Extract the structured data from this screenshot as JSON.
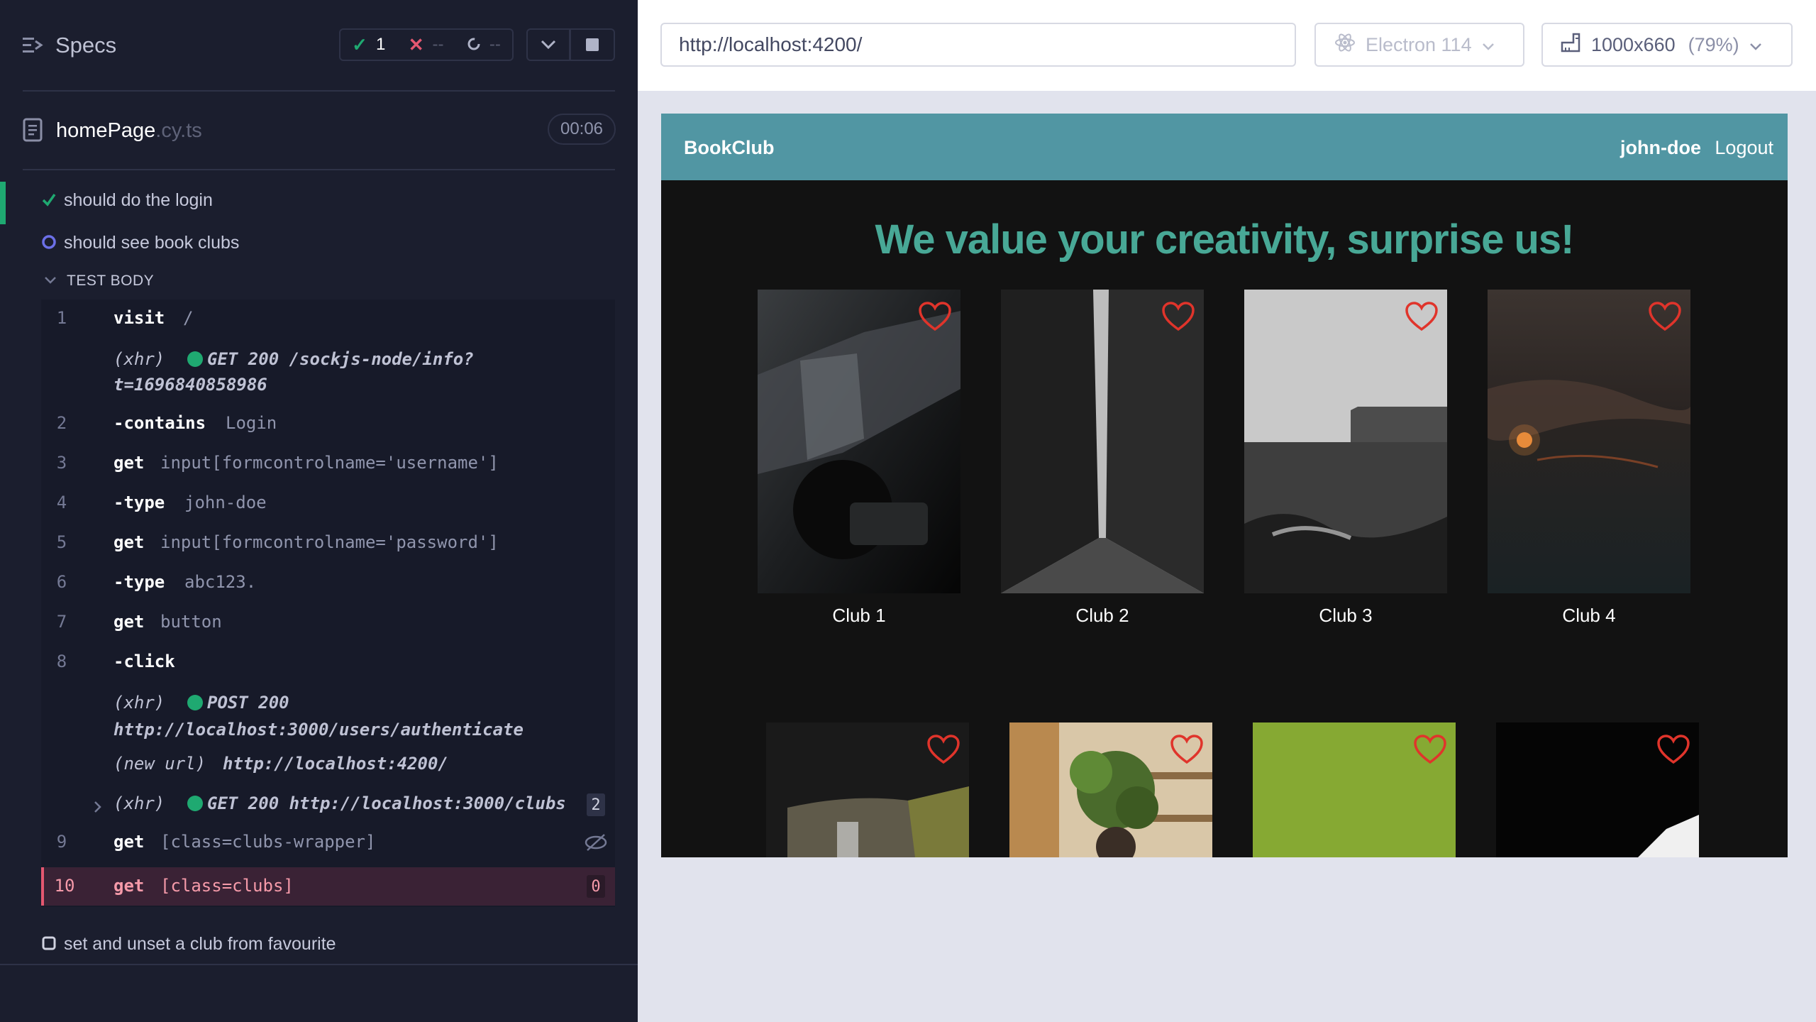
{
  "reporter": {
    "title": "Specs",
    "stats": {
      "passed": "1",
      "failed": "--",
      "pending": "--"
    },
    "file": {
      "name": "homePage",
      "ext": ".cy.ts",
      "duration": "00:06"
    },
    "tests": [
      {
        "label": "should do the login",
        "state": "passed"
      },
      {
        "label": "should see book clubs",
        "state": "running"
      },
      {
        "label": "set and unset a club from favourite",
        "state": "pending"
      }
    ],
    "test_body_label": "TEST BODY",
    "commands": [
      {
        "num": "1",
        "name": "visit",
        "msg": "/"
      },
      {
        "num": "",
        "name": "(xhr)",
        "msg": "GET 200 /sockjs-node/info?",
        "msg2": "t=1696840858986"
      },
      {
        "num": "2",
        "name": "-contains",
        "msg": "Login"
      },
      {
        "num": "3",
        "name": "get",
        "msg": "input[formcontrolname='username']"
      },
      {
        "num": "4",
        "name": "-type",
        "msg": "john-doe"
      },
      {
        "num": "5",
        "name": "get",
        "msg": "input[formcontrolname='password']"
      },
      {
        "num": "6",
        "name": "-type",
        "msg": "abc123."
      },
      {
        "num": "7",
        "name": "get",
        "msg": "button"
      },
      {
        "num": "8",
        "name": "-click",
        "msg": ""
      },
      {
        "num": "",
        "name": "(xhr)",
        "msg": "POST 200",
        "msg2": "http://localhost:3000/users/authenticate"
      },
      {
        "num": "",
        "name": "(new url)",
        "msg": "http://localhost:4200/"
      },
      {
        "num": "",
        "name": "(xhr)",
        "msg": "GET 200 http://localhost:3000/clubs",
        "badge": "2"
      },
      {
        "num": "9",
        "name": "get",
        "msg": "[class=clubs-wrapper]"
      },
      {
        "num": "10",
        "name": "get",
        "msg": "[class=clubs]",
        "badge": "0"
      }
    ]
  },
  "aut": {
    "url": "http://localhost:4200/",
    "browser": "Electron 114",
    "viewport": "1000x660",
    "zoom": "(79%)"
  },
  "app": {
    "brand": "BookClub",
    "user": "john-doe",
    "logout": "Logout",
    "hero": "We value your creativity, surprise us!",
    "clubs": [
      {
        "name": "Club 1"
      },
      {
        "name": "Club 2"
      },
      {
        "name": "Club 3"
      },
      {
        "name": "Club 4"
      },
      {
        "name": ""
      },
      {
        "name": ""
      },
      {
        "name": ""
      },
      {
        "name": ""
      }
    ]
  },
  "colors": {
    "reporter_bg": "#1b1e2e",
    "pass": "#1fa971",
    "fail": "#e45770",
    "app_nav": "#5196a3",
    "hero_text": "#48a896",
    "heart": "#e0342b"
  }
}
